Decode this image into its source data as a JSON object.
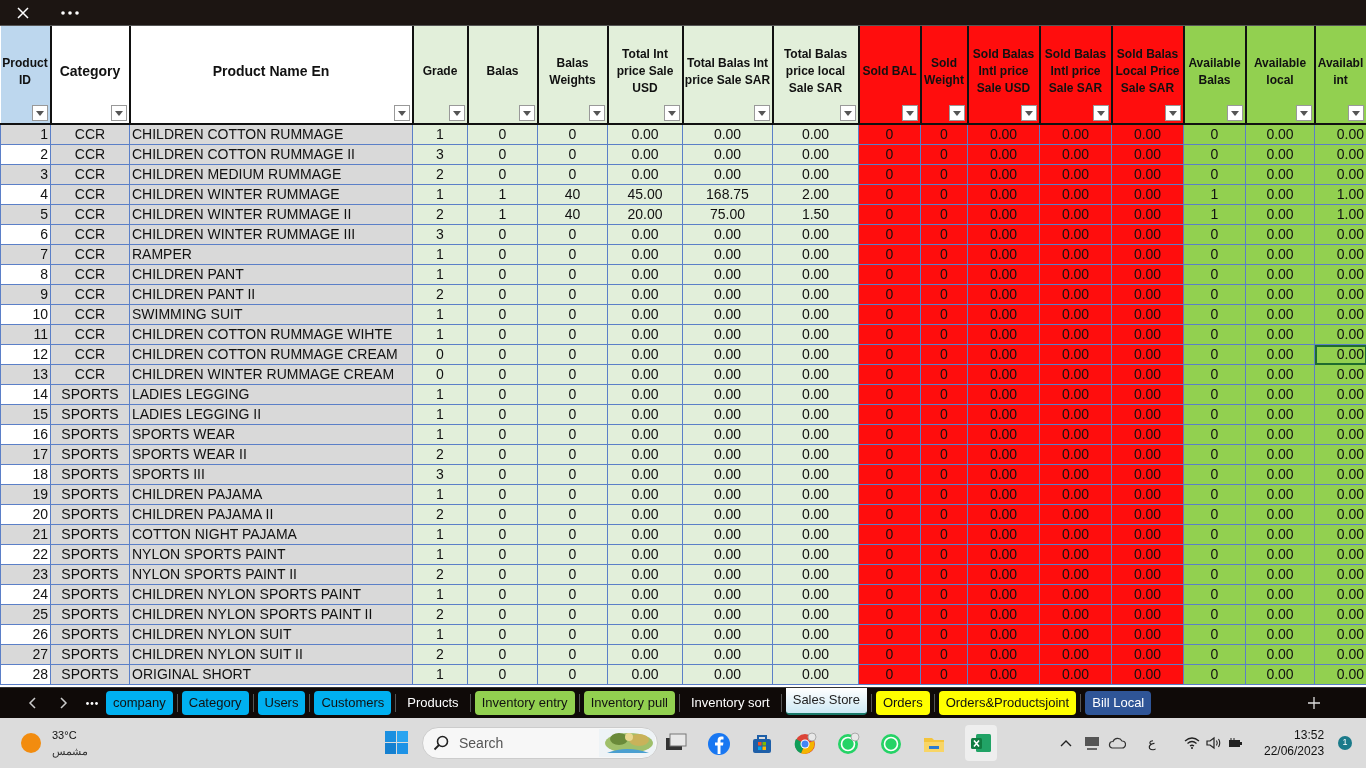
{
  "columns": [
    {
      "label": "Product ID",
      "color": "#bdd7ee"
    },
    {
      "label": "Category",
      "color": "#ffffff"
    },
    {
      "label": "Product Name En",
      "color": "#ffffff"
    },
    {
      "label": "Grade",
      "color": "#e2efda"
    },
    {
      "label": "Balas",
      "color": "#e2efda"
    },
    {
      "label": "Balas Weights",
      "color": "#e2efda"
    },
    {
      "label": "Total Int price Sale USD",
      "color": "#e2efda"
    },
    {
      "label": "Total Balas Int price Sale SAR",
      "color": "#e2efda"
    },
    {
      "label": "Total Balas price local Sale SAR",
      "color": "#e2efda"
    },
    {
      "label": "Sold BAL",
      "color": "#ff0d0d"
    },
    {
      "label": "Sold Weight",
      "color": "#ff0d0d"
    },
    {
      "label": "Sold Balas Intl price Sale USD",
      "color": "#ff0d0d"
    },
    {
      "label": "Sold Balas Intl price Sale SAR",
      "color": "#ff0d0d"
    },
    {
      "label": "Sold Balas Local Price Sale SAR",
      "color": "#ff0d0d"
    },
    {
      "label": "Available Balas",
      "color": "#92d050"
    },
    {
      "label": "Available local",
      "color": "#92d050"
    },
    {
      "label": "Availabl int",
      "color": "#92d050"
    }
  ],
  "rows": [
    {
      "selected": false,
      "cells": [
        "1",
        "CCR",
        "CHILDREN COTTON RUMMAGE",
        "1",
        "0",
        "0",
        "0.00",
        "0.00",
        "0.00",
        "0",
        "0",
        "0.00",
        "0.00",
        "0.00",
        "0",
        "0.00",
        "0.00"
      ]
    },
    {
      "selected": false,
      "cells": [
        "2",
        "CCR",
        "CHILDREN COTTON RUMMAGE II",
        "3",
        "0",
        "0",
        "0.00",
        "0.00",
        "0.00",
        "0",
        "0",
        "0.00",
        "0.00",
        "0.00",
        "0",
        "0.00",
        "0.00"
      ]
    },
    {
      "selected": false,
      "cells": [
        "3",
        "CCR",
        "CHILDREN MEDIUM RUMMAGE",
        "2",
        "0",
        "0",
        "0.00",
        "0.00",
        "0.00",
        "0",
        "0",
        "0.00",
        "0.00",
        "0.00",
        "0",
        "0.00",
        "0.00"
      ]
    },
    {
      "selected": false,
      "cells": [
        "4",
        "CCR",
        "CHILDREN WINTER RUMMAGE",
        "1",
        "1",
        "40",
        "45.00",
        "168.75",
        "2.00",
        "0",
        "0",
        "0.00",
        "0.00",
        "0.00",
        "1",
        "0.00",
        "1.00"
      ]
    },
    {
      "selected": false,
      "cells": [
        "5",
        "CCR",
        "CHILDREN WINTER RUMMAGE II",
        "2",
        "1",
        "40",
        "20.00",
        "75.00",
        "1.50",
        "0",
        "0",
        "0.00",
        "0.00",
        "0.00",
        "1",
        "0.00",
        "1.00"
      ]
    },
    {
      "selected": false,
      "cells": [
        "6",
        "CCR",
        "CHILDREN WINTER RUMMAGE III",
        "3",
        "0",
        "0",
        "0.00",
        "0.00",
        "0.00",
        "0",
        "0",
        "0.00",
        "0.00",
        "0.00",
        "0",
        "0.00",
        "0.00"
      ]
    },
    {
      "selected": false,
      "cells": [
        "7",
        "CCR",
        "RAMPER",
        "1",
        "0",
        "0",
        "0.00",
        "0.00",
        "0.00",
        "0",
        "0",
        "0.00",
        "0.00",
        "0.00",
        "0",
        "0.00",
        "0.00"
      ]
    },
    {
      "selected": false,
      "cells": [
        "8",
        "CCR",
        "CHILDREN PANT",
        "1",
        "0",
        "0",
        "0.00",
        "0.00",
        "0.00",
        "0",
        "0",
        "0.00",
        "0.00",
        "0.00",
        "0",
        "0.00",
        "0.00"
      ]
    },
    {
      "selected": false,
      "cells": [
        "9",
        "CCR",
        "CHILDREN PANT II",
        "2",
        "0",
        "0",
        "0.00",
        "0.00",
        "0.00",
        "0",
        "0",
        "0.00",
        "0.00",
        "0.00",
        "0",
        "0.00",
        "0.00"
      ]
    },
    {
      "selected": false,
      "cells": [
        "10",
        "CCR",
        "SWIMMING SUIT",
        "1",
        "0",
        "0",
        "0.00",
        "0.00",
        "0.00",
        "0",
        "0",
        "0.00",
        "0.00",
        "0.00",
        "0",
        "0.00",
        "0.00"
      ]
    },
    {
      "selected": false,
      "cells": [
        "11",
        "CCR",
        "CHILDREN COTTON RUMMAGE WIHTE",
        "1",
        "0",
        "0",
        "0.00",
        "0.00",
        "0.00",
        "0",
        "0",
        "0.00",
        "0.00",
        "0.00",
        "0",
        "0.00",
        "0.00"
      ]
    },
    {
      "selected": true,
      "cells": [
        "12",
        "CCR",
        "CHILDREN COTTON RUMMAGE CREAM",
        "0",
        "0",
        "0",
        "0.00",
        "0.00",
        "0.00",
        "0",
        "0",
        "0.00",
        "0.00",
        "0.00",
        "0",
        "0.00",
        "0.00"
      ]
    },
    {
      "selected": false,
      "cells": [
        "13",
        "CCR",
        "CHILDREN WINTER RUMMAGE CREAM",
        "0",
        "0",
        "0",
        "0.00",
        "0.00",
        "0.00",
        "0",
        "0",
        "0.00",
        "0.00",
        "0.00",
        "0",
        "0.00",
        "0.00"
      ]
    },
    {
      "selected": false,
      "cells": [
        "14",
        "SPORTS",
        "LADIES LEGGING",
        "1",
        "0",
        "0",
        "0.00",
        "0.00",
        "0.00",
        "0",
        "0",
        "0.00",
        "0.00",
        "0.00",
        "0",
        "0.00",
        "0.00"
      ]
    },
    {
      "selected": false,
      "cells": [
        "15",
        "SPORTS",
        "LADIES LEGGING II",
        "1",
        "0",
        "0",
        "0.00",
        "0.00",
        "0.00",
        "0",
        "0",
        "0.00",
        "0.00",
        "0.00",
        "0",
        "0.00",
        "0.00"
      ]
    },
    {
      "selected": false,
      "cells": [
        "16",
        "SPORTS",
        "SPORTS WEAR",
        "1",
        "0",
        "0",
        "0.00",
        "0.00",
        "0.00",
        "0",
        "0",
        "0.00",
        "0.00",
        "0.00",
        "0",
        "0.00",
        "0.00"
      ]
    },
    {
      "selected": false,
      "cells": [
        "17",
        "SPORTS",
        "SPORTS WEAR II",
        "2",
        "0",
        "0",
        "0.00",
        "0.00",
        "0.00",
        "0",
        "0",
        "0.00",
        "0.00",
        "0.00",
        "0",
        "0.00",
        "0.00"
      ]
    },
    {
      "selected": false,
      "cells": [
        "18",
        "SPORTS",
        "SPORTS III",
        "3",
        "0",
        "0",
        "0.00",
        "0.00",
        "0.00",
        "0",
        "0",
        "0.00",
        "0.00",
        "0.00",
        "0",
        "0.00",
        "0.00"
      ]
    },
    {
      "selected": false,
      "cells": [
        "19",
        "SPORTS",
        "CHILDREN PAJAMA",
        "1",
        "0",
        "0",
        "0.00",
        "0.00",
        "0.00",
        "0",
        "0",
        "0.00",
        "0.00",
        "0.00",
        "0",
        "0.00",
        "0.00"
      ]
    },
    {
      "selected": false,
      "cells": [
        "20",
        "SPORTS",
        "CHILDREN PAJAMA II",
        "2",
        "0",
        "0",
        "0.00",
        "0.00",
        "0.00",
        "0",
        "0",
        "0.00",
        "0.00",
        "0.00",
        "0",
        "0.00",
        "0.00"
      ]
    },
    {
      "selected": false,
      "cells": [
        "21",
        "SPORTS",
        "COTTON NIGHT PAJAMA",
        "1",
        "0",
        "0",
        "0.00",
        "0.00",
        "0.00",
        "0",
        "0",
        "0.00",
        "0.00",
        "0.00",
        "0",
        "0.00",
        "0.00"
      ]
    },
    {
      "selected": false,
      "cells": [
        "22",
        "SPORTS",
        "NYLON SPORTS PAINT",
        "1",
        "0",
        "0",
        "0.00",
        "0.00",
        "0.00",
        "0",
        "0",
        "0.00",
        "0.00",
        "0.00",
        "0",
        "0.00",
        "0.00"
      ]
    },
    {
      "selected": false,
      "cells": [
        "23",
        "SPORTS",
        "NYLON SPORTS PAINT II",
        "2",
        "0",
        "0",
        "0.00",
        "0.00",
        "0.00",
        "0",
        "0",
        "0.00",
        "0.00",
        "0.00",
        "0",
        "0.00",
        "0.00"
      ]
    },
    {
      "selected": false,
      "cells": [
        "24",
        "SPORTS",
        "CHILDREN NYLON SPORTS PAINT",
        "1",
        "0",
        "0",
        "0.00",
        "0.00",
        "0.00",
        "0",
        "0",
        "0.00",
        "0.00",
        "0.00",
        "0",
        "0.00",
        "0.00"
      ]
    },
    {
      "selected": false,
      "cells": [
        "25",
        "SPORTS",
        "CHILDREN NYLON SPORTS PAINT II",
        "2",
        "0",
        "0",
        "0.00",
        "0.00",
        "0.00",
        "0",
        "0",
        "0.00",
        "0.00",
        "0.00",
        "0",
        "0.00",
        "0.00"
      ]
    },
    {
      "selected": false,
      "cells": [
        "26",
        "SPORTS",
        "CHILDREN NYLON SUIT",
        "1",
        "0",
        "0",
        "0.00",
        "0.00",
        "0.00",
        "0",
        "0",
        "0.00",
        "0.00",
        "0.00",
        "0",
        "0.00",
        "0.00"
      ]
    },
    {
      "selected": false,
      "cells": [
        "27",
        "SPORTS",
        "CHILDREN NYLON SUIT II",
        "2",
        "0",
        "0",
        "0.00",
        "0.00",
        "0.00",
        "0",
        "0",
        "0.00",
        "0.00",
        "0.00",
        "0",
        "0.00",
        "0.00"
      ]
    },
    {
      "selected": false,
      "cells": [
        "28",
        "SPORTS",
        "ORIGINAL SHORT",
        "1",
        "0",
        "0",
        "0.00",
        "0.00",
        "0.00",
        "0",
        "0",
        "0.00",
        "0.00",
        "0.00",
        "0",
        "0.00",
        "0.00"
      ]
    }
  ],
  "sheet_tabs": [
    {
      "label": "company",
      "color": "#00b0f0",
      "selected": false
    },
    {
      "label": "Category",
      "color": "#00b0f0",
      "selected": false
    },
    {
      "label": "Users",
      "color": "#00b0f0",
      "selected": false
    },
    {
      "label": "Customers",
      "color": "#00b0f0",
      "selected": false
    },
    {
      "label": "Products",
      "selected": false
    },
    {
      "label": "Inventory entry",
      "color": "#92d050",
      "selected": false
    },
    {
      "label": "Inventory pull",
      "color": "#92d050",
      "selected": false
    },
    {
      "label": "Inventory sort",
      "selected": false
    },
    {
      "label": "Sales Store",
      "selected": true
    },
    {
      "label": "Orders",
      "color": "#ffff00",
      "selected": false
    },
    {
      "label": "Orders&Productsjoint",
      "color": "#ffff00",
      "selected": false
    },
    {
      "label": "Bill Local",
      "color": "#2f5597",
      "selected": false
    }
  ],
  "taskbar": {
    "weather": {
      "temperature": "33°C",
      "condition": "مشمس"
    },
    "search": {
      "placeholder": "Search"
    },
    "input_language": "ع",
    "time": "13:52",
    "date": "22/06/2023",
    "notification_count": "1"
  }
}
